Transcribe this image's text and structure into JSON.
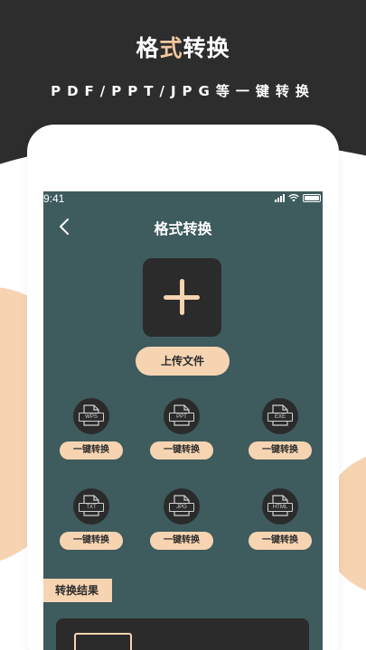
{
  "promo": {
    "title_prefix": "格",
    "title_accent": "式",
    "title_suffix": "转换",
    "subtitle": "PDF/PPT/JPG等一键转换"
  },
  "status_bar": {
    "time": "9:41"
  },
  "nav": {
    "title": "格式转换",
    "back_icon": "chevron-left-icon"
  },
  "upload": {
    "icon": "plus-icon",
    "button_label": "上传文件"
  },
  "formats": [
    {
      "name": "WPS",
      "button_label": "一键转换"
    },
    {
      "name": "PPT",
      "button_label": "一键转换"
    },
    {
      "name": "EXE",
      "button_label": "一键转换"
    },
    {
      "name": "TXT",
      "button_label": "一键转换"
    },
    {
      "name": "JPG",
      "button_label": "一键转换"
    },
    {
      "name": "HTML",
      "button_label": "一键转换"
    }
  ],
  "result": {
    "label": "转换结果"
  },
  "colors": {
    "dark_band": "#2d2d2d",
    "screen_bg": "#3e5b5d",
    "accent_peach": "#f6d4b2",
    "tile_dark": "#2b2b2b"
  }
}
